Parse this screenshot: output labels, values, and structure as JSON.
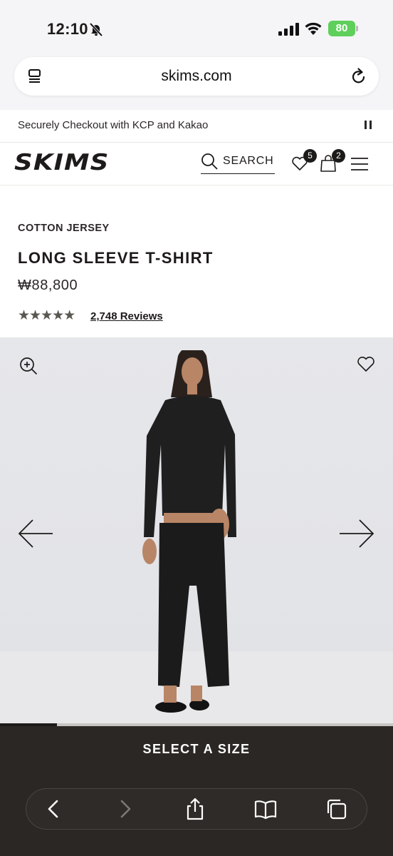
{
  "status_bar": {
    "time": "12:10",
    "battery": "80"
  },
  "browser": {
    "url": "skims.com"
  },
  "promo": {
    "text": "Securely Checkout with KCP and Kakao"
  },
  "header": {
    "logo": "SKIMS",
    "search_label": "SEARCH",
    "wishlist_count": "5",
    "cart_count": "2"
  },
  "product": {
    "category": "COTTON JERSEY",
    "title": "LONG SLEEVE T-SHIRT",
    "price": "₩88,800",
    "rating_stars": "★★★★★",
    "rating_value": 4.7,
    "reviews_label": "2,748 Reviews"
  },
  "gallery": {
    "progress": 0.145
  },
  "cta": {
    "label": "SELECT A SIZE"
  },
  "colors": {
    "brand_dark": "#2b2724",
    "text": "#1d1b19",
    "battery_green": "#5fcf5b",
    "gallery_bg": "#e4e5e9"
  },
  "icons": [
    "bell-slash-icon",
    "signal-icon",
    "wifi-icon",
    "reader-icon",
    "reload-icon",
    "pause-icon",
    "search-icon",
    "heart-icon",
    "bag-icon",
    "menu-icon",
    "zoom-in-icon",
    "arrow-left-icon",
    "arrow-right-icon",
    "back-icon",
    "forward-icon",
    "share-icon",
    "bookmarks-icon",
    "tabs-icon"
  ]
}
